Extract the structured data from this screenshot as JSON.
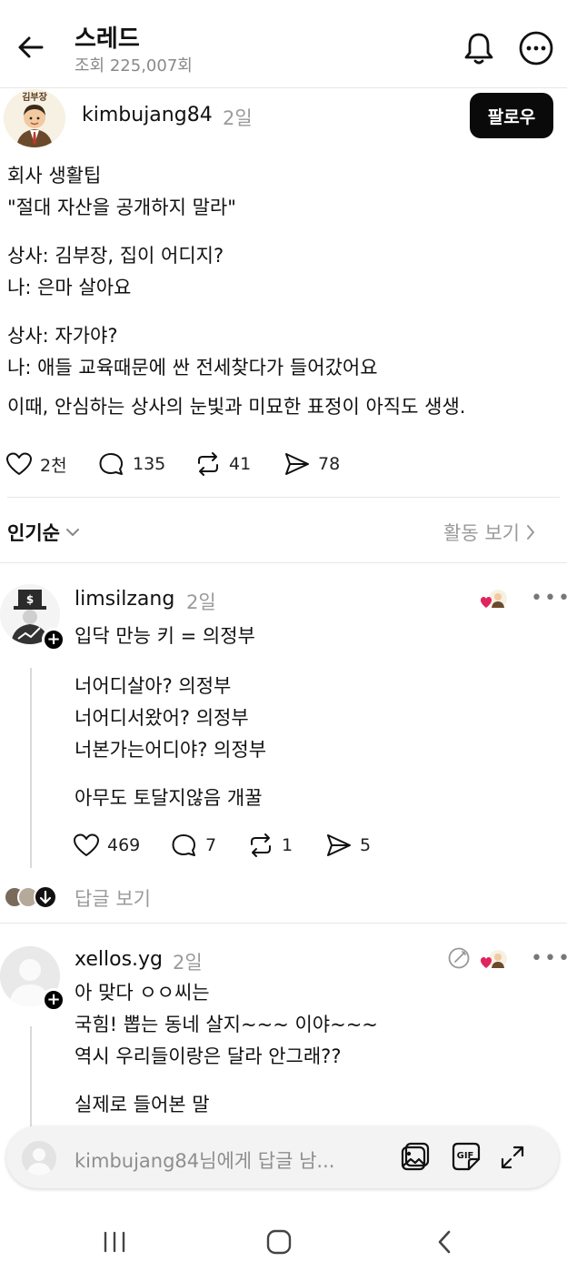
{
  "header": {
    "title": "스레드",
    "views": "조회 225,007회"
  },
  "post": {
    "avatar_caption": "김부장",
    "username": "kimbujang84",
    "time": "2일",
    "follow_label": "팔로우",
    "lines": [
      "회사 생활팁",
      "\"절대 자산을 공개하지 말라\"",
      "상사: 김부장, 집이 어디지?",
      "나: 은마 살아요",
      "상사: 자가야?",
      "나: 애들 교육때문에 싼 전세찾다가 들어갔어요",
      "이때, 안심하는 상사의 눈빛과 미묘한 표정이 아직도 생생."
    ],
    "likes": "2천",
    "comments": "135",
    "reposts": "41",
    "shares": "78"
  },
  "sort": {
    "label": "인기순",
    "activity_label": "활동 보기"
  },
  "reply1": {
    "username": "limsilzang",
    "time": "2일",
    "lines": [
      "입닥 만능 키 = 의정부",
      "너어디살아? 의정부",
      "너어디서왔어? 의정부",
      "너본가는어디야? 의정부",
      "아무도 토달지않음 개꿀"
    ],
    "likes": "469",
    "comments": "7",
    "reposts": "1",
    "shares": "5",
    "view_replies": "답글 보기"
  },
  "reply2": {
    "username": "xellos.yg",
    "time": "2일",
    "lines": [
      "아 맞다 ㅇㅇ씨는",
      "국힘! 뽑는 동네 살지~~~ 이야~~~",
      "역시 우리들이랑은 달라 안그래??",
      "실제로 들어본 말"
    ]
  },
  "composer": {
    "placeholder": "kimbujang84님에게 답글 남..."
  },
  "icons": {
    "back": "arrow-left-icon",
    "bell": "bell-icon",
    "more": "more-circle-icon",
    "heart": "heart-icon",
    "comment": "comment-icon",
    "repost": "repost-icon",
    "share": "send-icon",
    "gallery": "gallery-icon",
    "gif": "gif-icon",
    "expand": "expand-icon"
  },
  "colors": {
    "accent": "#000000",
    "muted": "#9a9a9a",
    "heart_red": "#e0245e"
  }
}
